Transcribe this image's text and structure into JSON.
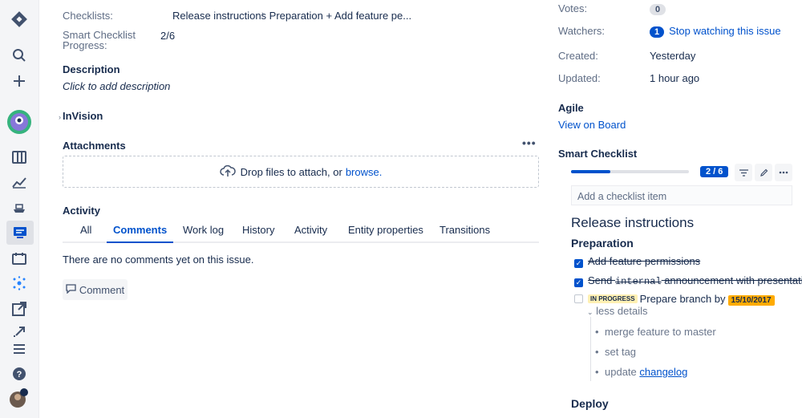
{
  "nav": {
    "icons": [
      "jira-logo-icon",
      "search-icon",
      "plus-icon",
      "avatar-icon",
      "board-icon",
      "reports-icon",
      "releases-icon",
      "smart-checklist-icon",
      "calendar-icon",
      "network-icon",
      "share-icon",
      "expand-icon",
      "menu-icon",
      "help-icon",
      "user-avatar-icon"
    ]
  },
  "main": {
    "checklists_label": "Checklists:",
    "checklists_value": "Release instructions Preparation + Add feature pe...",
    "progress_label": "Smart Checklist Progress:",
    "progress_value": "2/6",
    "description_heading": "Description",
    "description_placeholder": "Click to add description",
    "invision_heading": "InVision",
    "attachments_heading": "Attachments",
    "more_label": "•••",
    "dropzone_text": "Drop files to attach, or",
    "dropzone_link": "browse.",
    "activity_heading": "Activity",
    "tabs": [
      "All",
      "Comments",
      "Work log",
      "History",
      "Activity",
      "Entity properties",
      "Transitions"
    ],
    "active_tab": "Comments",
    "no_comments": "There are no comments yet on this issue.",
    "comment_button": "Comment"
  },
  "side": {
    "votes_label": "Votes:",
    "votes_count": "0",
    "watchers_label": "Watchers:",
    "watchers_count": "1",
    "watch_link": "Stop watching this issue",
    "created_label": "Created:",
    "created_value": "Yesterday",
    "updated_label": "Updated:",
    "updated_value": "1 hour ago",
    "agile_heading": "Agile",
    "agile_link": "View on Board",
    "sc_heading": "Smart Checklist",
    "sc_progress_badge": "2 / 6",
    "sc_progress_fraction": 0.33,
    "sc_add_placeholder": "Add a checklist item",
    "sc_title": "Release instructions",
    "sc_section": "Preparation",
    "items": [
      {
        "text": "Add feature permissions",
        "checked": true
      },
      {
        "pre": "Send ",
        "code": "internal",
        "post": " announcement with presentation",
        "checked": true
      },
      {
        "status": "IN PROGRESS",
        "text": "Prepare branch by",
        "date": "15/10/2017",
        "checked": false
      }
    ],
    "less_details": "less details",
    "subitems": [
      "merge feature to master",
      "set tag",
      "update"
    ],
    "changelog_link": "changelog",
    "deploy": "Deploy"
  },
  "colors": {
    "accent": "#0052cc",
    "date_badge": "#ffab00",
    "lozenge": "#fff0b3"
  }
}
